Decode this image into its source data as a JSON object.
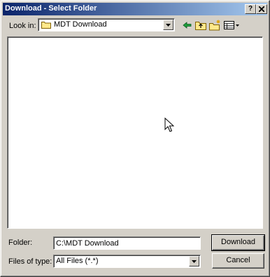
{
  "window": {
    "title": "Download - Select Folder",
    "help_button": "?",
    "close_button": "x"
  },
  "toolbar": {
    "lookin_label": "Look in:",
    "lookin_value": "MDT Download",
    "icons": [
      "back-arrow-icon",
      "up-folder-icon",
      "new-folder-icon",
      "view-menu-icon"
    ]
  },
  "file_list": {
    "items": []
  },
  "form": {
    "folder_label": "Folder:",
    "folder_value": "C:\\MDT Download",
    "type_label": "Files of type:",
    "type_value": "All Files (*.*)"
  },
  "buttons": {
    "download": "Download",
    "cancel": "Cancel"
  },
  "colors": {
    "titlebar_start": "#0a246a",
    "titlebar_end": "#a6caf0",
    "dialog_face": "#d4d0c8"
  }
}
